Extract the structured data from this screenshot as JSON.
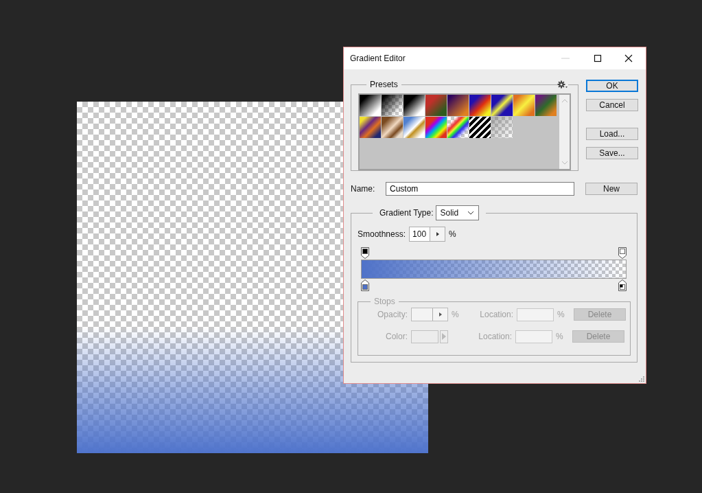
{
  "window": {
    "title": "Gradient Editor"
  },
  "presets": {
    "title": "Presets"
  },
  "buttons": [
    {
      "label": "OK",
      "default": true
    },
    {
      "label": "Cancel",
      "default": false
    },
    {
      "label": "Load...",
      "default": false
    },
    {
      "label": "Save...",
      "default": false
    }
  ],
  "name": {
    "label": "Name:",
    "value": "Custom",
    "button": "New"
  },
  "gradient": {
    "type_label": "Gradient Type:",
    "type_value": "Solid",
    "smoothness_label": "Smoothness:",
    "smoothness_value": "100",
    "smoothness_unit": "%",
    "opacity_stops": [
      {
        "color": "#000000"
      },
      {
        "color": "#ffffff"
      }
    ],
    "color_stops": [
      {
        "kind": "color",
        "color": "#4f72c8"
      },
      {
        "kind": "foreground"
      }
    ]
  },
  "stops": {
    "title": "Stops",
    "disabled": true,
    "rows": [
      {
        "kind": "opacity",
        "label": "Opacity:",
        "unit": "%",
        "location_label": "Location:",
        "location_unit": "%",
        "delete": "Delete"
      },
      {
        "kind": "color",
        "label": "Color:",
        "location_label": "Location:",
        "location_unit": "%",
        "delete": "Delete"
      }
    ]
  }
}
